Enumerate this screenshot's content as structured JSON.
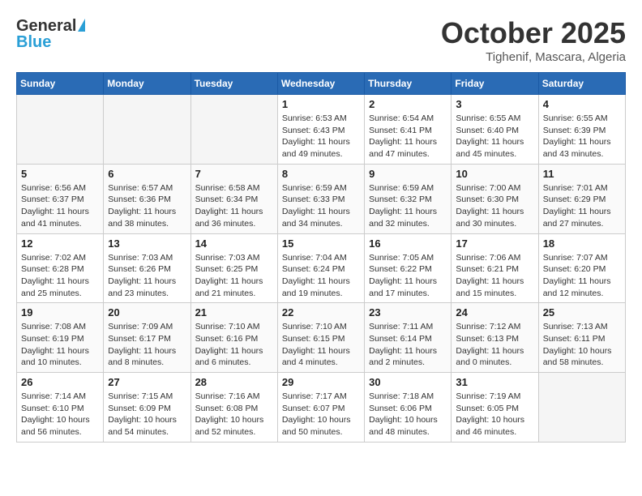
{
  "header": {
    "logo_general": "General",
    "logo_blue": "Blue",
    "month_title": "October 2025",
    "subtitle": "Tighenif, Mascara, Algeria"
  },
  "weekdays": [
    "Sunday",
    "Monday",
    "Tuesday",
    "Wednesday",
    "Thursday",
    "Friday",
    "Saturday"
  ],
  "weeks": [
    [
      {
        "day": "",
        "info": ""
      },
      {
        "day": "",
        "info": ""
      },
      {
        "day": "",
        "info": ""
      },
      {
        "day": "1",
        "info": "Sunrise: 6:53 AM\nSunset: 6:43 PM\nDaylight: 11 hours and 49 minutes."
      },
      {
        "day": "2",
        "info": "Sunrise: 6:54 AM\nSunset: 6:41 PM\nDaylight: 11 hours and 47 minutes."
      },
      {
        "day": "3",
        "info": "Sunrise: 6:55 AM\nSunset: 6:40 PM\nDaylight: 11 hours and 45 minutes."
      },
      {
        "day": "4",
        "info": "Sunrise: 6:55 AM\nSunset: 6:39 PM\nDaylight: 11 hours and 43 minutes."
      }
    ],
    [
      {
        "day": "5",
        "info": "Sunrise: 6:56 AM\nSunset: 6:37 PM\nDaylight: 11 hours and 41 minutes."
      },
      {
        "day": "6",
        "info": "Sunrise: 6:57 AM\nSunset: 6:36 PM\nDaylight: 11 hours and 38 minutes."
      },
      {
        "day": "7",
        "info": "Sunrise: 6:58 AM\nSunset: 6:34 PM\nDaylight: 11 hours and 36 minutes."
      },
      {
        "day": "8",
        "info": "Sunrise: 6:59 AM\nSunset: 6:33 PM\nDaylight: 11 hours and 34 minutes."
      },
      {
        "day": "9",
        "info": "Sunrise: 6:59 AM\nSunset: 6:32 PM\nDaylight: 11 hours and 32 minutes."
      },
      {
        "day": "10",
        "info": "Sunrise: 7:00 AM\nSunset: 6:30 PM\nDaylight: 11 hours and 30 minutes."
      },
      {
        "day": "11",
        "info": "Sunrise: 7:01 AM\nSunset: 6:29 PM\nDaylight: 11 hours and 27 minutes."
      }
    ],
    [
      {
        "day": "12",
        "info": "Sunrise: 7:02 AM\nSunset: 6:28 PM\nDaylight: 11 hours and 25 minutes."
      },
      {
        "day": "13",
        "info": "Sunrise: 7:03 AM\nSunset: 6:26 PM\nDaylight: 11 hours and 23 minutes."
      },
      {
        "day": "14",
        "info": "Sunrise: 7:03 AM\nSunset: 6:25 PM\nDaylight: 11 hours and 21 minutes."
      },
      {
        "day": "15",
        "info": "Sunrise: 7:04 AM\nSunset: 6:24 PM\nDaylight: 11 hours and 19 minutes."
      },
      {
        "day": "16",
        "info": "Sunrise: 7:05 AM\nSunset: 6:22 PM\nDaylight: 11 hours and 17 minutes."
      },
      {
        "day": "17",
        "info": "Sunrise: 7:06 AM\nSunset: 6:21 PM\nDaylight: 11 hours and 15 minutes."
      },
      {
        "day": "18",
        "info": "Sunrise: 7:07 AM\nSunset: 6:20 PM\nDaylight: 11 hours and 12 minutes."
      }
    ],
    [
      {
        "day": "19",
        "info": "Sunrise: 7:08 AM\nSunset: 6:19 PM\nDaylight: 11 hours and 10 minutes."
      },
      {
        "day": "20",
        "info": "Sunrise: 7:09 AM\nSunset: 6:17 PM\nDaylight: 11 hours and 8 minutes."
      },
      {
        "day": "21",
        "info": "Sunrise: 7:10 AM\nSunset: 6:16 PM\nDaylight: 11 hours and 6 minutes."
      },
      {
        "day": "22",
        "info": "Sunrise: 7:10 AM\nSunset: 6:15 PM\nDaylight: 11 hours and 4 minutes."
      },
      {
        "day": "23",
        "info": "Sunrise: 7:11 AM\nSunset: 6:14 PM\nDaylight: 11 hours and 2 minutes."
      },
      {
        "day": "24",
        "info": "Sunrise: 7:12 AM\nSunset: 6:13 PM\nDaylight: 11 hours and 0 minutes."
      },
      {
        "day": "25",
        "info": "Sunrise: 7:13 AM\nSunset: 6:11 PM\nDaylight: 10 hours and 58 minutes."
      }
    ],
    [
      {
        "day": "26",
        "info": "Sunrise: 7:14 AM\nSunset: 6:10 PM\nDaylight: 10 hours and 56 minutes."
      },
      {
        "day": "27",
        "info": "Sunrise: 7:15 AM\nSunset: 6:09 PM\nDaylight: 10 hours and 54 minutes."
      },
      {
        "day": "28",
        "info": "Sunrise: 7:16 AM\nSunset: 6:08 PM\nDaylight: 10 hours and 52 minutes."
      },
      {
        "day": "29",
        "info": "Sunrise: 7:17 AM\nSunset: 6:07 PM\nDaylight: 10 hours and 50 minutes."
      },
      {
        "day": "30",
        "info": "Sunrise: 7:18 AM\nSunset: 6:06 PM\nDaylight: 10 hours and 48 minutes."
      },
      {
        "day": "31",
        "info": "Sunrise: 7:19 AM\nSunset: 6:05 PM\nDaylight: 10 hours and 46 minutes."
      },
      {
        "day": "",
        "info": ""
      }
    ]
  ]
}
